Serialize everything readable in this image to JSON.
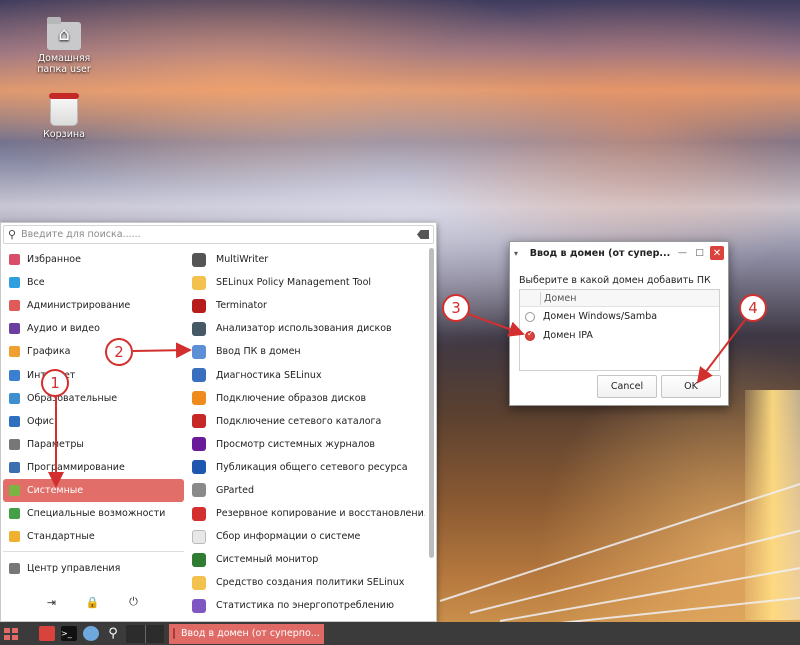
{
  "desktop": {
    "icons": [
      {
        "label": "Домашняя папка user",
        "icon": "home-folder-icon"
      },
      {
        "label": "Корзина",
        "icon": "trash-icon"
      }
    ]
  },
  "menu": {
    "search_placeholder": "Введите для поиска......",
    "categories": [
      {
        "label": "Избранное",
        "color": "#d94d6a"
      },
      {
        "label": "Все",
        "color": "#2f9fe0"
      },
      {
        "label": "Администрирование",
        "color": "#e05a5a"
      },
      {
        "label": "Аудио и видео",
        "color": "#6b3fa0"
      },
      {
        "label": "Графика",
        "color": "#f0a030"
      },
      {
        "label": "Интернет",
        "color": "#3a7fd0"
      },
      {
        "label": "Образовательные",
        "color": "#3d8fd0"
      },
      {
        "label": "Офис",
        "color": "#2e6fc0"
      },
      {
        "label": "Параметры",
        "color": "#777777"
      },
      {
        "label": "Программирование",
        "color": "#3a6fb0"
      },
      {
        "label": "Системные",
        "color": "#7cb342",
        "active": true
      },
      {
        "label": "Специальные возможности",
        "color": "#43a047"
      },
      {
        "label": "Стандартные",
        "color": "#f0b030"
      }
    ],
    "control_center": "Центр управления",
    "actions": [
      "logout-icon",
      "lock-icon",
      "power-icon"
    ],
    "apps": [
      {
        "label": "MultiWriter",
        "color": "#555555"
      },
      {
        "label": "SELinux Policy Management Tool",
        "color": "#f2c14e"
      },
      {
        "label": "Terminator",
        "color": "#b71c1c"
      },
      {
        "label": "Анализатор использования дисков",
        "color": "#455a64"
      },
      {
        "label": "Ввод ПК в домен",
        "color": "#5c8fd6"
      },
      {
        "label": "Диагностика SELinux",
        "color": "#3a6fc0"
      },
      {
        "label": "Подключение образов дисков",
        "color": "#ef8a1e"
      },
      {
        "label": "Подключение сетевого каталога",
        "color": "#c62828"
      },
      {
        "label": "Просмотр системных журналов",
        "color": "#6a1b9a"
      },
      {
        "label": "Публикация общего сетевого ресурса",
        "color": "#1e56b0"
      },
      {
        "label": "GParted",
        "color": "#8a8a8a"
      },
      {
        "label": "Резервное копирование и восстановлени...",
        "color": "#d32f2f"
      },
      {
        "label": "Сбор информации о системе",
        "color": "#e8e8e8"
      },
      {
        "label": "Системный монитор",
        "color": "#2e7d32"
      },
      {
        "label": "Средство создания политики SELinux",
        "color": "#f2c14e"
      },
      {
        "label": "Статистика по энергопотреблению",
        "color": "#7e57c2"
      }
    ]
  },
  "dialog": {
    "title": "Ввод в домен (от супер...",
    "prompt": "Выберите в какой домен добавить ПК",
    "column_header": "Домен",
    "options": [
      {
        "label": "Домен Windows/Samba",
        "checked": false
      },
      {
        "label": "Домен IPA",
        "checked": true
      }
    ],
    "cancel_label": "Cancel",
    "ok_label": "OK"
  },
  "annotations": [
    "1",
    "2",
    "3",
    "4"
  ],
  "annotation_color": "#d32f2f",
  "taskbar": {
    "task_label": "Ввод в домен (от суперпо..."
  }
}
